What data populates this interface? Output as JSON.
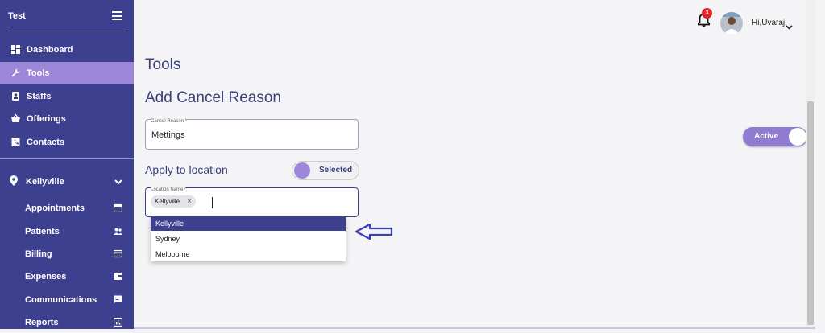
{
  "sidebar": {
    "title": "Test",
    "items": [
      {
        "label": "Dashboard",
        "icon": "dashboard-icon"
      },
      {
        "label": "Tools",
        "icon": "wrench-icon",
        "active": true
      },
      {
        "label": "Staffs",
        "icon": "id-badge-icon"
      },
      {
        "label": "Offerings",
        "icon": "basket-icon"
      },
      {
        "label": "Contacts",
        "icon": "phone-book-icon"
      }
    ],
    "location": {
      "label": "Kellyville",
      "icon": "location-pin-icon"
    },
    "sub_items": [
      {
        "label": "Appointments",
        "icon": "calendar-icon"
      },
      {
        "label": "Patients",
        "icon": "people-icon"
      },
      {
        "label": "Billing",
        "icon": "credit-card-icon"
      },
      {
        "label": "Expenses",
        "icon": "wallet-icon"
      },
      {
        "label": "Communications",
        "icon": "chat-icon"
      },
      {
        "label": "Reports",
        "icon": "report-icon"
      }
    ]
  },
  "header": {
    "notification_count": "3",
    "greeting": "Hi,Uvaraj"
  },
  "main": {
    "page_title": "Tools",
    "section_title": "Add Cancel Reason",
    "cancel_reason": {
      "label": "Cancel Reason *",
      "value": "Mettings"
    },
    "active_toggle": {
      "label": "Active",
      "on": true
    },
    "apply_location": {
      "label": "Apply to location",
      "toggle_label": "Selected"
    },
    "location_name": {
      "label": "Location Name *",
      "chip": "Kellyville",
      "chip_remove": "×"
    },
    "dropdown_options": [
      "Kellyville",
      "Sydney",
      "Melbourne"
    ]
  },
  "colors": {
    "sidebar_bg": "#3d3f8f",
    "accent": "#9d87d9",
    "title": "#3a3f78",
    "badge": "#e02424"
  }
}
